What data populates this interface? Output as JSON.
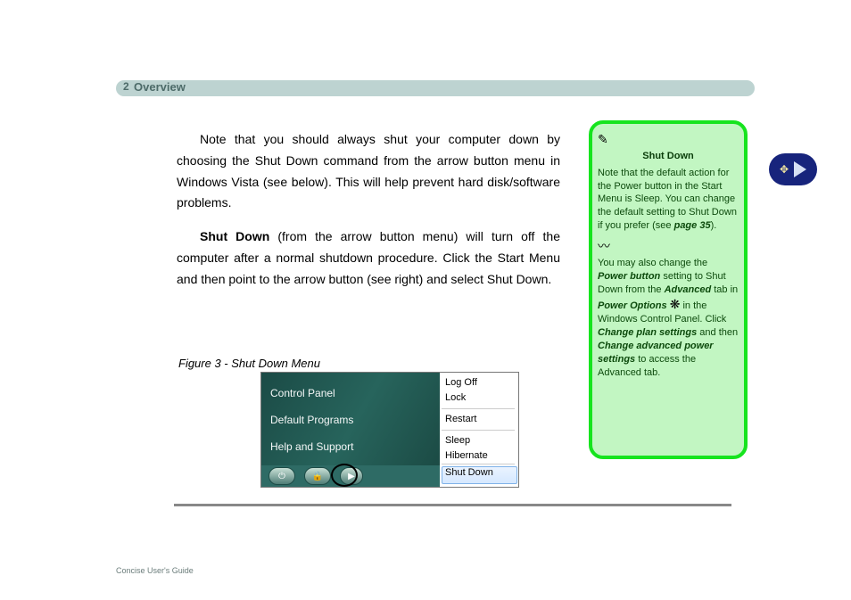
{
  "header": {
    "page_left": "2",
    "title": "Overview"
  },
  "content": {
    "p1": "Note that you should always shut your computer down by choosing the Shut Down command from the arrow button menu in Windows Vista (see below). This will help prevent hard disk/software problems.",
    "p2_label": "Shut Down",
    "p2_rest": " (from the arrow button menu) will turn off the computer after a normal shutdown procedure. Click the Start Menu and then point to the arrow button (see right) and select Shut Down.",
    "figcap": "Figure 3 - Shut Down Menu"
  },
  "figure": {
    "left_items": [
      "Control Panel",
      "Default Programs",
      "Help and Support"
    ],
    "buttons": {
      "power": "⏻",
      "lock": "🔒",
      "arrow": "▶"
    },
    "right_items": [
      "Log Off",
      "Lock",
      "Restart",
      "Sleep",
      "Hibernate",
      "Shut Down"
    ]
  },
  "sidebar": {
    "heading": "Shut Down",
    "icon_pen": "✎",
    "p1": "Note that the default action for the Power button in the Start Menu is Sleep. You can change the default setting to Shut Down if you prefer (see ",
    "p1_ref": "page 35",
    "p1_tail": ").",
    "icon_wave": "〰",
    "p2a": "You may also change the ",
    "p2b": "Power button",
    "p2c": " setting to Shut Down from the ",
    "p2d": "Advanced",
    "p2e": " tab in ",
    "p2f": "Power Options",
    "icon_gear": "❋",
    "p2g": " in the Windows Control Panel. Click ",
    "p2h": "Change plan settings",
    "p2i": " and then ",
    "p2j": "Change advanced power settings",
    "p2k": " to access the Advanced tab."
  },
  "page_turn": {
    "icon": "✥"
  },
  "footer": "Concise User's Guide"
}
